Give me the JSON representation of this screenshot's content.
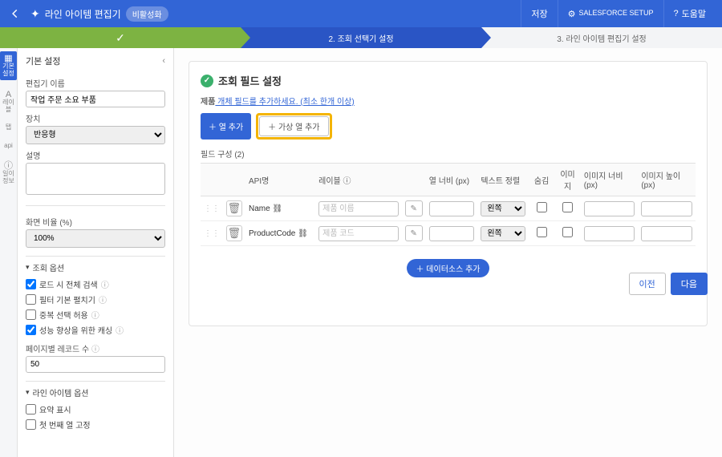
{
  "topbar": {
    "title": "라인 아이템 편집기",
    "badge": "비활성화",
    "save": "저장",
    "setup": "SALESFORCE SETUP",
    "help": "도움말"
  },
  "wizard": {
    "step2": "2. 조회 선택기 설정",
    "step3": "3. 라인 아이템 편집기 설정"
  },
  "rail": {
    "r1": "기본 설정",
    "r2": "레이블",
    "r3": "탭",
    "r4": "api",
    "r5": "일이 정보"
  },
  "sidebar": {
    "header": "기본 설정",
    "name_label": "편집기 이름",
    "name_value": "작업 주문 소요 부품",
    "device_label": "장치",
    "device_value": "반응형",
    "desc_label": "설명",
    "desc_value": "",
    "screen_label": "화면 비율 (%)",
    "screen_value": "100%",
    "sect_search": "조회 옵션",
    "cb_full_search": "로드 시 전체 검색",
    "cb_filter_expand": "필터 기본 펼치기",
    "cb_dup_allow": "중복 선택 허용",
    "cb_perf_cache": "성능 향상을 위한 캐싱",
    "page_records_label": "페이지별 레코드 수",
    "page_records_value": "50",
    "sect_line": "라인 아이템 옵션",
    "cb_summary": "요약 표시",
    "cb_first_col": "첫 번째 열 고정"
  },
  "panel": {
    "title": "조회 필드 설정",
    "sub_prefix": "제품",
    "sub_text": " 개체 필드를 추가하세요. (최소 한개 이상)",
    "add_col": "열 추가",
    "add_vcol": "가상 열 추가",
    "field_count_label": "필드 구성 (2)",
    "th_api": "API명",
    "th_label": "레이블",
    "th_width": "열 너비 (px)",
    "th_align": "텍스트 정렬",
    "th_hide": "숨김",
    "th_image": "이미지",
    "th_imgw": "이미지 너비 (px)",
    "th_imgh": "이미지 높이 (px)",
    "rows": [
      {
        "api": "Name",
        "label_ph": "제품 이름",
        "align": "왼쪽"
      },
      {
        "api": "ProductCode",
        "label_ph": "제품 코드",
        "align": "왼쪽"
      }
    ],
    "add_datasource": "데이터소스 추가"
  },
  "footer": {
    "prev": "이전",
    "next": "다음"
  }
}
